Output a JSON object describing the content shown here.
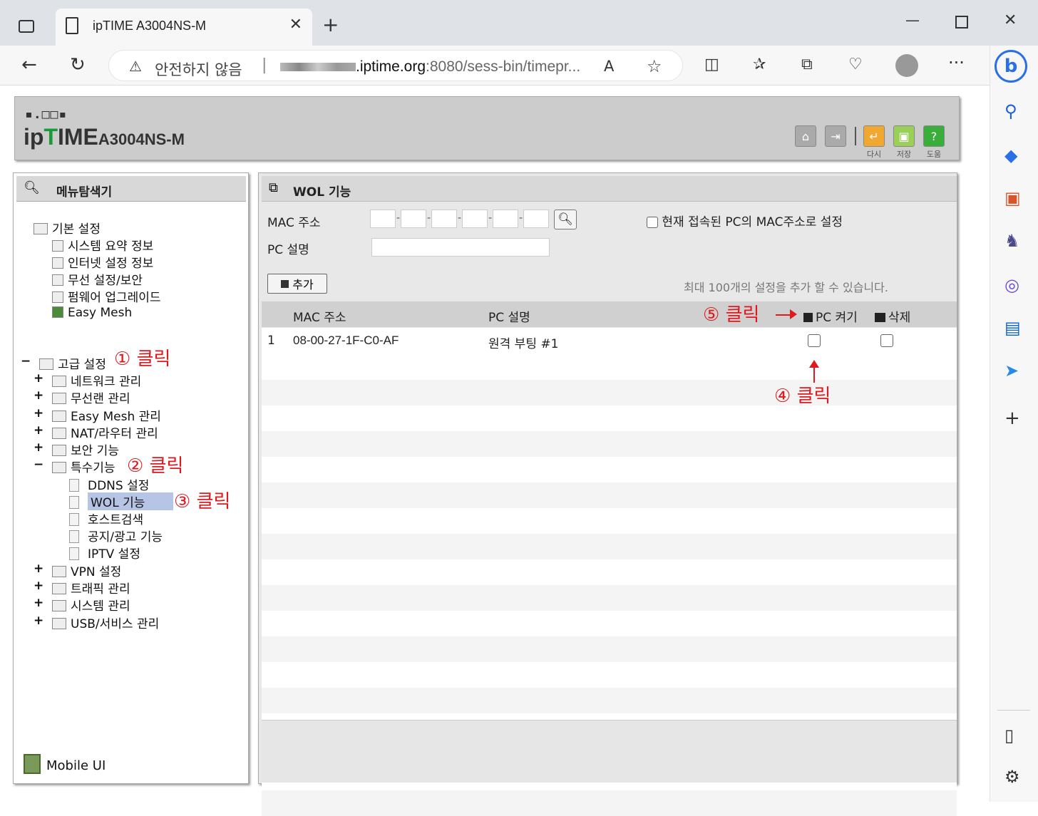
{
  "browser": {
    "tab_title": "ipTIME A3004NS-M",
    "tab_close": "✕",
    "new_tab": "+",
    "insecure_label": "안전하지 않음",
    "url_host": ".iptime.org",
    "url_path": ":8080/sess-bin/timepr...",
    "url_sep": "|"
  },
  "router": {
    "logo_dots": "▪.□□▪",
    "logo_ip": "ip",
    "logo_t": "T",
    "logo_ime": "IME",
    "model": "A3004NS-M",
    "header_buttons": [
      {
        "label": "다시"
      },
      {
        "label": "저장"
      },
      {
        "label": "도움"
      }
    ]
  },
  "nav": {
    "title": "메뉴탐색기",
    "basic": {
      "label": "기본 설정",
      "items": [
        "시스템 요약 정보",
        "인터넷 설정 정보",
        "무선 설정/보안",
        "펌웨어 업그레이드",
        "Easy Mesh"
      ]
    },
    "advanced": {
      "label": "고급 설정",
      "items": [
        "네트워크 관리",
        "무선랜 관리",
        "Easy Mesh 관리",
        "NAT/라우터 관리",
        "보안 기능"
      ],
      "special": {
        "label": "특수기능",
        "items": [
          "DDNS 설정",
          "WOL 기능",
          "호스트검색",
          "공지/광고 기능",
          "IPTV 설정"
        ]
      },
      "more_items": [
        "VPN 설정",
        "트래픽 관리",
        "시스템 관리",
        "USB/서비스 관리"
      ]
    },
    "mobile_ui": "Mobile UI",
    "plus": "+",
    "minus": "−"
  },
  "wol": {
    "title": "WOL 기능",
    "mac_label": "MAC 주소",
    "pc_desc_label": "PC 설명",
    "current_pc_checkbox_label": "현재 접속된 PC의 MAC주소로 설정",
    "add_button": "추가",
    "max_note": "최대 100개의 설정을 추가 할 수 있습니다.",
    "columns": {
      "mac": "MAC 주소",
      "pc_desc": "PC 설명",
      "power_on": "PC 켜기",
      "delete": "삭제"
    },
    "rows": [
      {
        "index": "1",
        "mac": "08-00-27-1F-C0-AF",
        "desc": "원격 부팅 #1"
      }
    ]
  },
  "annotations": {
    "step1": "① 클릭",
    "step2": "② 클릭",
    "step3": "③ 클릭",
    "step4": "④ 클릭",
    "step5": "⑤ 클릭"
  },
  "colors": {
    "annotation_red": "#e0191e",
    "selected_bg": "#b6c4e6",
    "logo_green": "#1a9a3a"
  }
}
